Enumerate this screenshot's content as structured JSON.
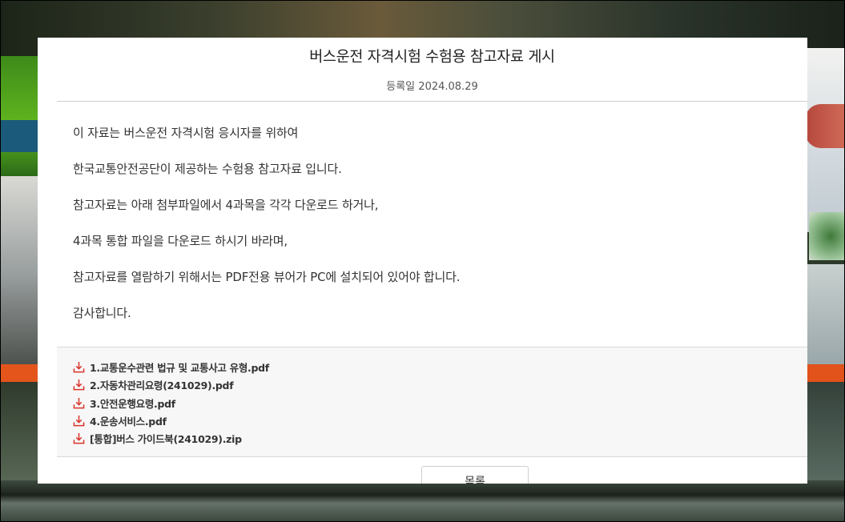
{
  "post": {
    "title": "버스운전 자격시험 수험용 참고자료 게시",
    "date_label": "등록일",
    "date": "2024.08.29",
    "paragraphs": [
      "이 자료는 버스운전 자격시험 응시자를 위하여",
      "한국교통안전공단이 제공하는 수험용 참고자료 입니다.",
      "참고자료는 아래 첨부파일에서 4과목을 각각 다운로드 하거나,",
      "4과목 통합 파일을 다운로드 하시기 바라며,",
      "참고자료를 열람하기 위해서는 PDF전용 뷰어가 PC에 설치되어 있어야 합니다.",
      "감사합니다."
    ]
  },
  "attachments": [
    "1.교통운수관련 법규 및 교통사고 유형.pdf",
    "2.자동차관리요령(241029).pdf",
    "3.안전운행요령.pdf",
    "4.운송서비스.pdf",
    "[통합]버스 가이드북(241029).zip"
  ],
  "icons": {
    "attachment": "download-icon"
  },
  "colors": {
    "download_icon": "#d9332b"
  },
  "actions": {
    "list_label": "목록"
  }
}
